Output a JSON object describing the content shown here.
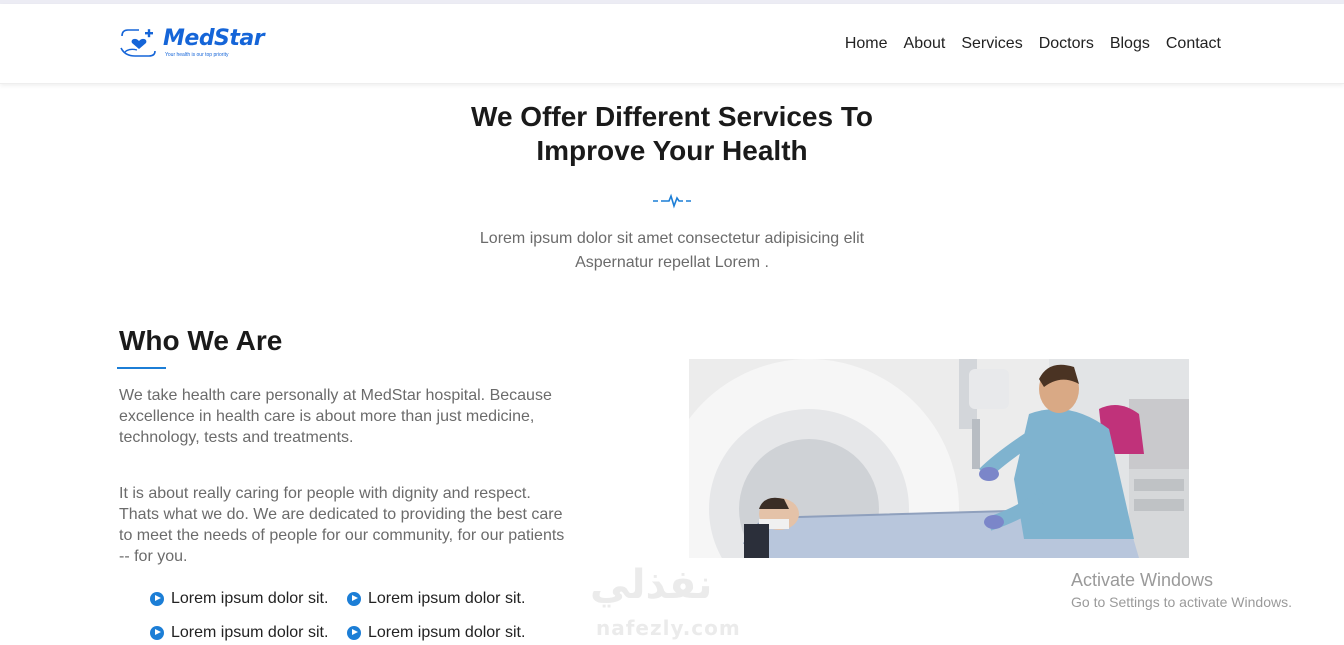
{
  "brand": {
    "name": "MedStar",
    "tagline": "Your health is our top priority"
  },
  "nav": {
    "items": [
      "Home",
      "About",
      "Services",
      "Doctors",
      "Blogs",
      "Contact"
    ]
  },
  "hero": {
    "title_line1": "We Offer Different Services To",
    "title_line2": "Improve Your Health",
    "subtitle_line1": "Lorem ipsum dolor sit amet consectetur adipisicing elit",
    "subtitle_line2": "Aspernatur repellat Lorem ."
  },
  "about": {
    "title": "Who We Are",
    "paragraph1": "We take health care personally at MedStar hospital. Because excellence in health care is about more than just medicine, technology, tests and treatments.",
    "paragraph2": "It is about really caring for people with dignity and respect. Thats what we do. We are dedicated to providing the best care to meet the needs of people for our community, for our patients -- for you.",
    "features": [
      "Lorem ipsum dolor sit.",
      "Lorem ipsum dolor sit.",
      "Lorem ipsum dolor sit.",
      "Lorem ipsum dolor sit."
    ]
  },
  "watermark": {
    "arabic": "نفذلي",
    "latin": "nafezly.com"
  },
  "os_notice": {
    "title": "Activate Windows",
    "subtitle": "Go to Settings to activate Windows."
  },
  "colors": {
    "accent": "#1c7ed6",
    "brand": "#1565d8",
    "body_text": "#6b6b6b",
    "heading": "#1a1a1a"
  },
  "icons": [
    "medstar-logo-icon",
    "heartbeat-divider-icon",
    "play-circle-icon"
  ]
}
